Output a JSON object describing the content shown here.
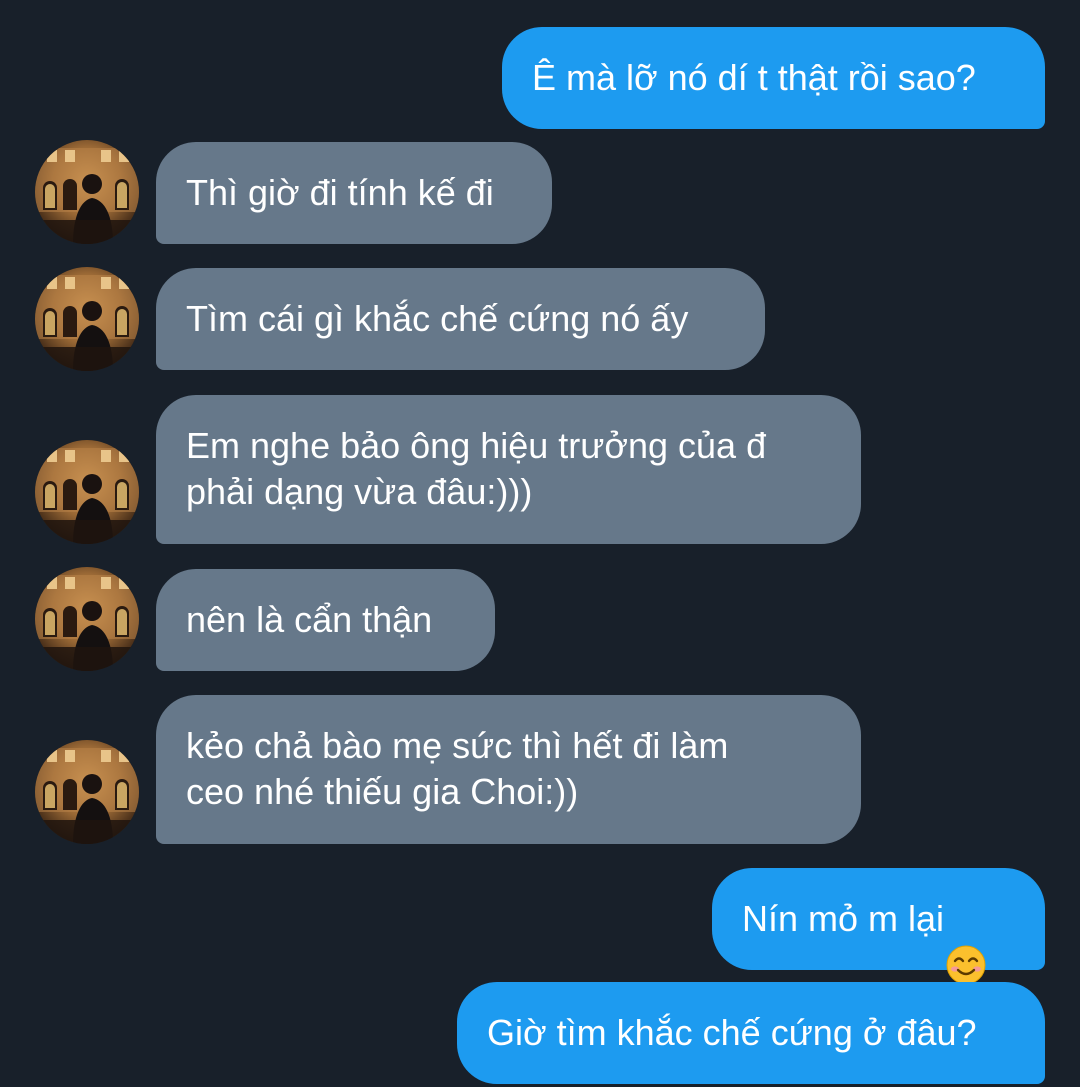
{
  "conversation": {
    "messages": [
      {
        "id": "m1",
        "sender": "me",
        "text": "Ê mà lỡ nó dí t thật rồi sao?"
      },
      {
        "id": "m2",
        "sender": "them",
        "text": "Thì giờ đi tính kế đi"
      },
      {
        "id": "m3",
        "sender": "them",
        "text": "Tìm cái gì khắc chế cứng nó ấy"
      },
      {
        "id": "m4",
        "sender": "them",
        "text": "Em nghe bảo ông hiệu trưởng của đ\nphải dạng vừa đâu:)))"
      },
      {
        "id": "m5",
        "sender": "them",
        "text": "nên là cẩn thận"
      },
      {
        "id": "m6",
        "sender": "them",
        "text": "kẻo chả bào mẹ sức thì hết đi làm\nceo nhé thiếu gia Choi:))"
      },
      {
        "id": "m7",
        "sender": "me",
        "text": "Nín mỏ m lại",
        "emoji": "smiling-face-with-smiling-eyes"
      },
      {
        "id": "m8",
        "sender": "me",
        "text": "Giờ tìm khắc chế cứng ở đâu?"
      }
    ]
  },
  "colors": {
    "background": "#18202a",
    "outgoing_bubble": "#1d9bf0",
    "incoming_bubble": "#66788a",
    "text": "#ffffff"
  },
  "icons": {
    "avatar": "contact-avatar-photo",
    "emoji": "smiling-face-with-smiling-eyes-emoji"
  }
}
